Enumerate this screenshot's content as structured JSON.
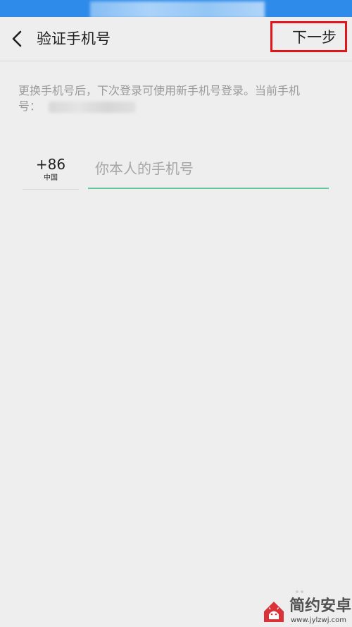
{
  "header": {
    "title": "验证手机号",
    "next_label": "下一步",
    "back_icon": "chevron-left-icon"
  },
  "hint": {
    "line1": "更换手机号后，下次登录可使用新手机号登录。当前手机",
    "line2": "号："
  },
  "country": {
    "code": "+86",
    "name": "中国"
  },
  "phone": {
    "value": "",
    "placeholder": "你本人的手机号"
  },
  "watermark": {
    "text": "简约安卓网",
    "url": "www.jylzwj.com",
    "icon": "android-logo-icon"
  },
  "colors": {
    "status_bar": "#2F8BEA",
    "background": "#EEEEEE",
    "next_highlight": "#E0161B",
    "input_underline": "#60C99C",
    "hint_text": "#9A9A9A"
  }
}
